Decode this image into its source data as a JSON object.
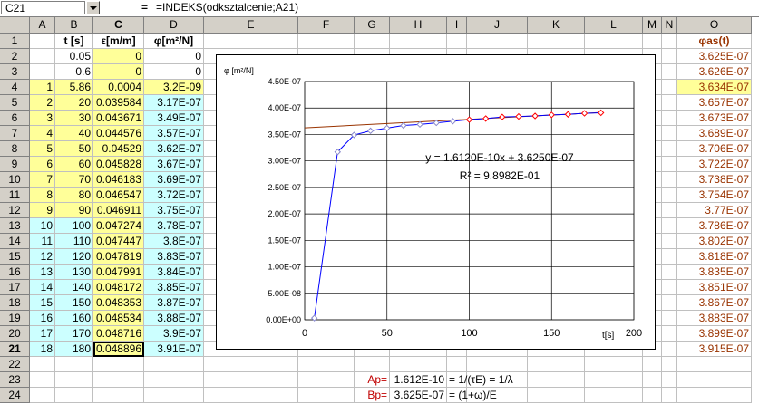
{
  "formula_bar": {
    "name_box": "C21",
    "equals": "=",
    "formula": "=INDEKS(odksztalcenie;A21)"
  },
  "columns": [
    "A",
    "B",
    "C",
    "D",
    "E",
    "F",
    "G",
    "H",
    "I",
    "J",
    "K",
    "L",
    "M",
    "N",
    "O"
  ],
  "rows": [
    {
      "num": "1",
      "A": "",
      "B": "t [s]",
      "C": "ε[m/m]",
      "D": "φ[m²/N]",
      "O": "φas(t)"
    },
    {
      "num": "2",
      "A": "",
      "B": "0.05",
      "C": "0",
      "D": "0",
      "O": "3.625E-07"
    },
    {
      "num": "3",
      "A": "",
      "B": "0.6",
      "C": "0",
      "D": "0",
      "O": "3.626E-07"
    },
    {
      "num": "4",
      "A": "1",
      "B": "5.86",
      "C": "0.0004",
      "D": "3.2E-09",
      "O": "3.634E-07"
    },
    {
      "num": "5",
      "A": "2",
      "B": "20",
      "C": "0.039584",
      "D": "3.17E-07",
      "O": "3.657E-07"
    },
    {
      "num": "6",
      "A": "3",
      "B": "30",
      "C": "0.043671",
      "D": "3.49E-07",
      "O": "3.673E-07"
    },
    {
      "num": "7",
      "A": "4",
      "B": "40",
      "C": "0.044576",
      "D": "3.57E-07",
      "O": "3.689E-07"
    },
    {
      "num": "8",
      "A": "5",
      "B": "50",
      "C": "0.04529",
      "D": "3.62E-07",
      "O": "3.706E-07"
    },
    {
      "num": "9",
      "A": "6",
      "B": "60",
      "C": "0.045828",
      "D": "3.67E-07",
      "O": "3.722E-07"
    },
    {
      "num": "10",
      "A": "7",
      "B": "70",
      "C": "0.046183",
      "D": "3.69E-07",
      "O": "3.738E-07"
    },
    {
      "num": "11",
      "A": "8",
      "B": "80",
      "C": "0.046547",
      "D": "3.72E-07",
      "O": "3.754E-07"
    },
    {
      "num": "12",
      "A": "9",
      "B": "90",
      "C": "0.046911",
      "D": "3.75E-07",
      "O": "3.77E-07"
    },
    {
      "num": "13",
      "A": "10",
      "B": "100",
      "C": "0.047274",
      "D": "3.78E-07",
      "O": "3.786E-07"
    },
    {
      "num": "14",
      "A": "11",
      "B": "110",
      "C": "0.047447",
      "D": "3.8E-07",
      "O": "3.802E-07"
    },
    {
      "num": "15",
      "A": "12",
      "B": "120",
      "C": "0.047819",
      "D": "3.83E-07",
      "O": "3.818E-07"
    },
    {
      "num": "16",
      "A": "13",
      "B": "130",
      "C": "0.047991",
      "D": "3.84E-07",
      "O": "3.835E-07"
    },
    {
      "num": "17",
      "A": "14",
      "B": "140",
      "C": "0.048172",
      "D": "3.85E-07",
      "O": "3.851E-07"
    },
    {
      "num": "18",
      "A": "15",
      "B": "150",
      "C": "0.048353",
      "D": "3.87E-07",
      "O": "3.867E-07"
    },
    {
      "num": "19",
      "A": "16",
      "B": "160",
      "C": "0.048534",
      "D": "3.88E-07",
      "O": "3.883E-07"
    },
    {
      "num": "20",
      "A": "17",
      "B": "170",
      "C": "0.048716",
      "D": "3.9E-07",
      "O": "3.899E-07"
    },
    {
      "num": "21",
      "A": "18",
      "B": "180",
      "C": "0.048896",
      "D": "3.91E-07",
      "O": "3.915E-07"
    },
    {
      "num": "22"
    },
    {
      "num": "23",
      "G": "Ap=",
      "H": "1.612E-10",
      "I": "= 1/(τE) = 1/λ"
    },
    {
      "num": "24",
      "G": "Bp=",
      "H": "3.625E-07",
      "I": "= (1+ω)/E"
    }
  ],
  "colors": {
    "yellow": "#ffff99",
    "cyan": "#ccffff",
    "red_label": "#c00000",
    "brown_header": "#993300",
    "data_line": "#0000ff",
    "trend_line": "#993300",
    "marker": "#ff0000"
  },
  "chart_data": {
    "type": "scatter",
    "ylabel": "φ [m²/N]",
    "xlabel": "t[s]",
    "xlim": [
      0,
      200
    ],
    "ylim": [
      0,
      4.5e-07
    ],
    "xticks": [
      "0",
      "50",
      "100",
      "150",
      "200"
    ],
    "yticks": [
      "0.00E+00",
      "5.00E-08",
      "1.00E-07",
      "1.50E-07",
      "2.00E-07",
      "2.50E-07",
      "3.00E-07",
      "3.50E-07",
      "4.00E-07",
      "4.50E-07"
    ],
    "grid": true,
    "series": [
      {
        "x": [
          5.86,
          20,
          30,
          40,
          50,
          60,
          70,
          80,
          90,
          100,
          110,
          120,
          130,
          140,
          150,
          160,
          170,
          180
        ],
        "y": [
          3.2e-09,
          3.17e-07,
          3.49e-07,
          3.57e-07,
          3.62e-07,
          3.67e-07,
          3.69e-07,
          3.72e-07,
          3.75e-07,
          3.78e-07,
          3.8e-07,
          3.83e-07,
          3.84e-07,
          3.85e-07,
          3.87e-07,
          3.88e-07,
          3.9e-07,
          3.91e-07
        ]
      }
    ],
    "trendline": {
      "slope": 1.612e-10,
      "intercept": 3.625e-07,
      "x_from": 0,
      "x_to": 180
    },
    "annotations": [
      "y = 1.6120E-10x + 3.6250E-07",
      "R² = 9.8982E-01"
    ]
  }
}
